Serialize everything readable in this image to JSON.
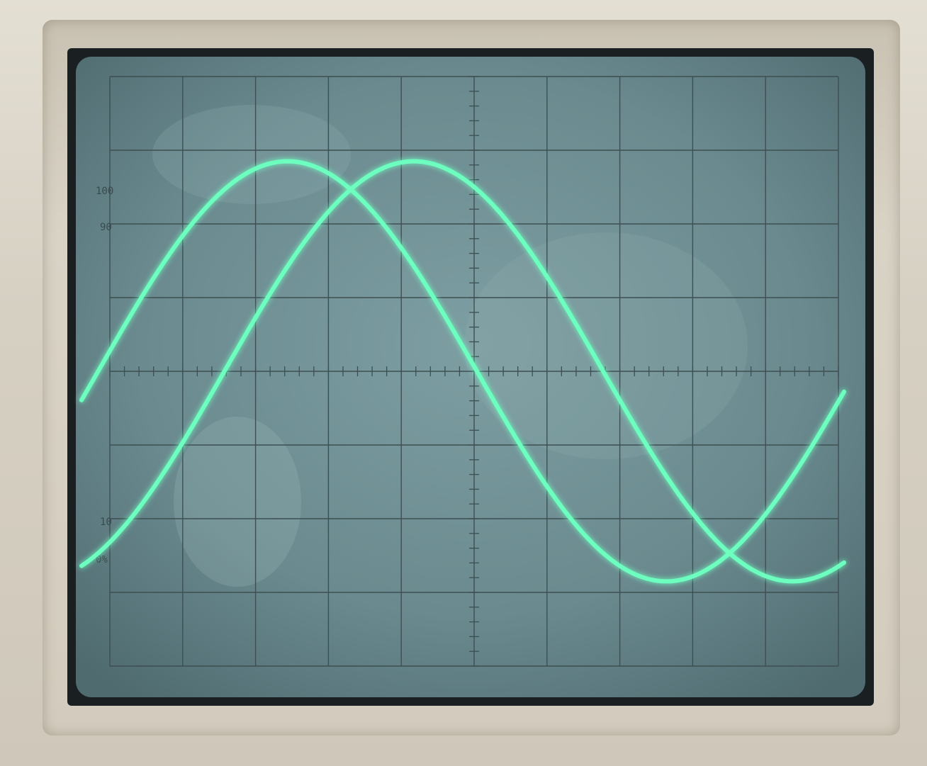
{
  "graticule": {
    "labels": [
      "100",
      "90",
      "10",
      "0%"
    ]
  },
  "colors": {
    "phosphor": "#6dffbf",
    "screen": "#6f8f94",
    "grid": "#3e4f52",
    "bezel": "#d8d2c4"
  },
  "traces": [
    {
      "name": "",
      "waveform": "sine",
      "phase_deg": 0
    },
    {
      "name": "",
      "waveform": "sine",
      "phase_deg": -60
    }
  ]
}
